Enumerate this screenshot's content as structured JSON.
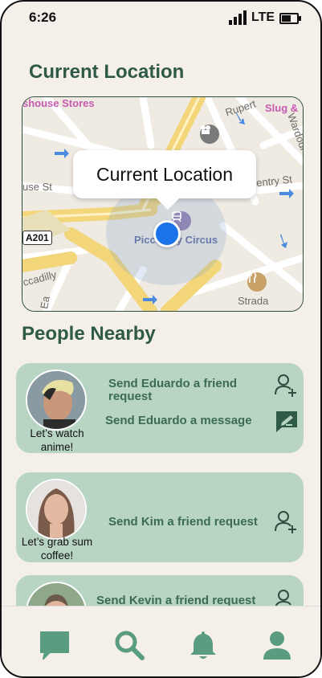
{
  "status_bar": {
    "time": "6:26",
    "network": "LTE"
  },
  "current_location": {
    "title": "Current Location",
    "callout": "Current Location",
    "map_labels": {
      "stores": "shouse Stores",
      "rupert": "Rupert",
      "slug": "Slug &",
      "wardour": "Wardour",
      "coventry": "Coventry St",
      "house_st": "use St",
      "road_number": "A201",
      "piccadilly_circus": "Piccadilly Circus",
      "piccadilly": "ccadilly",
      "ea": "Ea",
      "strada": "Strada"
    }
  },
  "people_nearby": {
    "title": "People Nearby",
    "people": [
      {
        "status": "Let’s watch anime!",
        "actions": [
          "Send Eduardo a friend request",
          "Send Eduardo a message"
        ]
      },
      {
        "status": "Let’s grab sum coffee!",
        "actions": [
          "Send Kim a friend request"
        ]
      },
      {
        "status": "",
        "actions": [
          "Send Kevin a friend request"
        ]
      }
    ]
  },
  "colors": {
    "accent": "#5a9c7f",
    "card": "#b8d4c3",
    "title": "#2f5a45",
    "background": "#f4efe9"
  },
  "icons": [
    "chat-icon",
    "search-icon",
    "bell-icon",
    "profile-icon",
    "add-friend-icon",
    "message-icon"
  ]
}
